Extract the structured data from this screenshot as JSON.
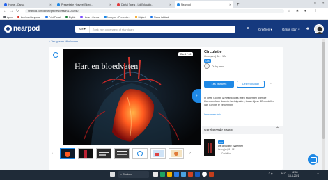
{
  "browser": {
    "tabs": [
      {
        "label": "Home - Canva",
        "color": "#2563eb"
      },
      {
        "label": "Presentatie Hoeveel Bloed...",
        "color": "#1e88e5"
      },
      {
        "label": "Digital Tafels - Lid Educatio...",
        "color": "#e03a3a"
      },
      {
        "label": "Nearpod",
        "color": "#1e88e5"
      }
    ],
    "new_tab": "+",
    "url": "nearpod.com/library/preview/lesson-LC02040",
    "bookmarks": [
      {
        "label": "Apps",
        "color": "#5f6368"
      },
      {
        "label": "Leerkrachtenportal",
        "color": "#d93025"
      },
      {
        "label": "Print Portal",
        "color": "#1a73e8"
      },
      {
        "label": "Digibit",
        "color": "#188038"
      },
      {
        "label": "Home - Canva",
        "color": "#7c4dff"
      },
      {
        "label": "Nearpod - Presenta...",
        "color": "#1e88e5"
      },
      {
        "label": "Digicel",
        "color": "#f29900"
      },
      {
        "label": "Nieuw tabblad",
        "color": "#1a73e8"
      }
    ]
  },
  "nearpod": {
    "logo_text": "nearpod",
    "search_filter": "Alle",
    "search_placeholder": "Zoek een onderwerp of standaard",
    "nav_create": "Creëren",
    "nav_upgrade": "Gratis start"
  },
  "breadcrumb": "< Terugkeren Mijn lessen",
  "lesson": {
    "slide_title": "Hart en bloedvaten",
    "slide_counter": "Dia 1 / 46",
    "title": "Circulatie",
    "subject": "Groep(en) 6e - 12e",
    "badge": "Les",
    "author": "Dit by Inox",
    "primary_button": "Les bewaren",
    "secondary_button": "Delen/opslaan",
    "more_button": "···",
    "description": "In deze Corinth & Nearpod-les leren studenten over de bloedsomloop door de hartsignalen, tussentijdse 3D-modellen van Corinth te verkennen.",
    "more_link": "Lees meer info"
  },
  "related": {
    "heading": "Gerelateerde lessen",
    "item_badge": "Les",
    "item_title": "De circulatie systemen",
    "item_subtitle": "Groep(en) 8 - 12",
    "item_author": "Corinthia"
  },
  "taskbar": {
    "search": "Zoeken",
    "time": "12:08",
    "date": "18-4-2021",
    "tray_language": "NLD"
  }
}
